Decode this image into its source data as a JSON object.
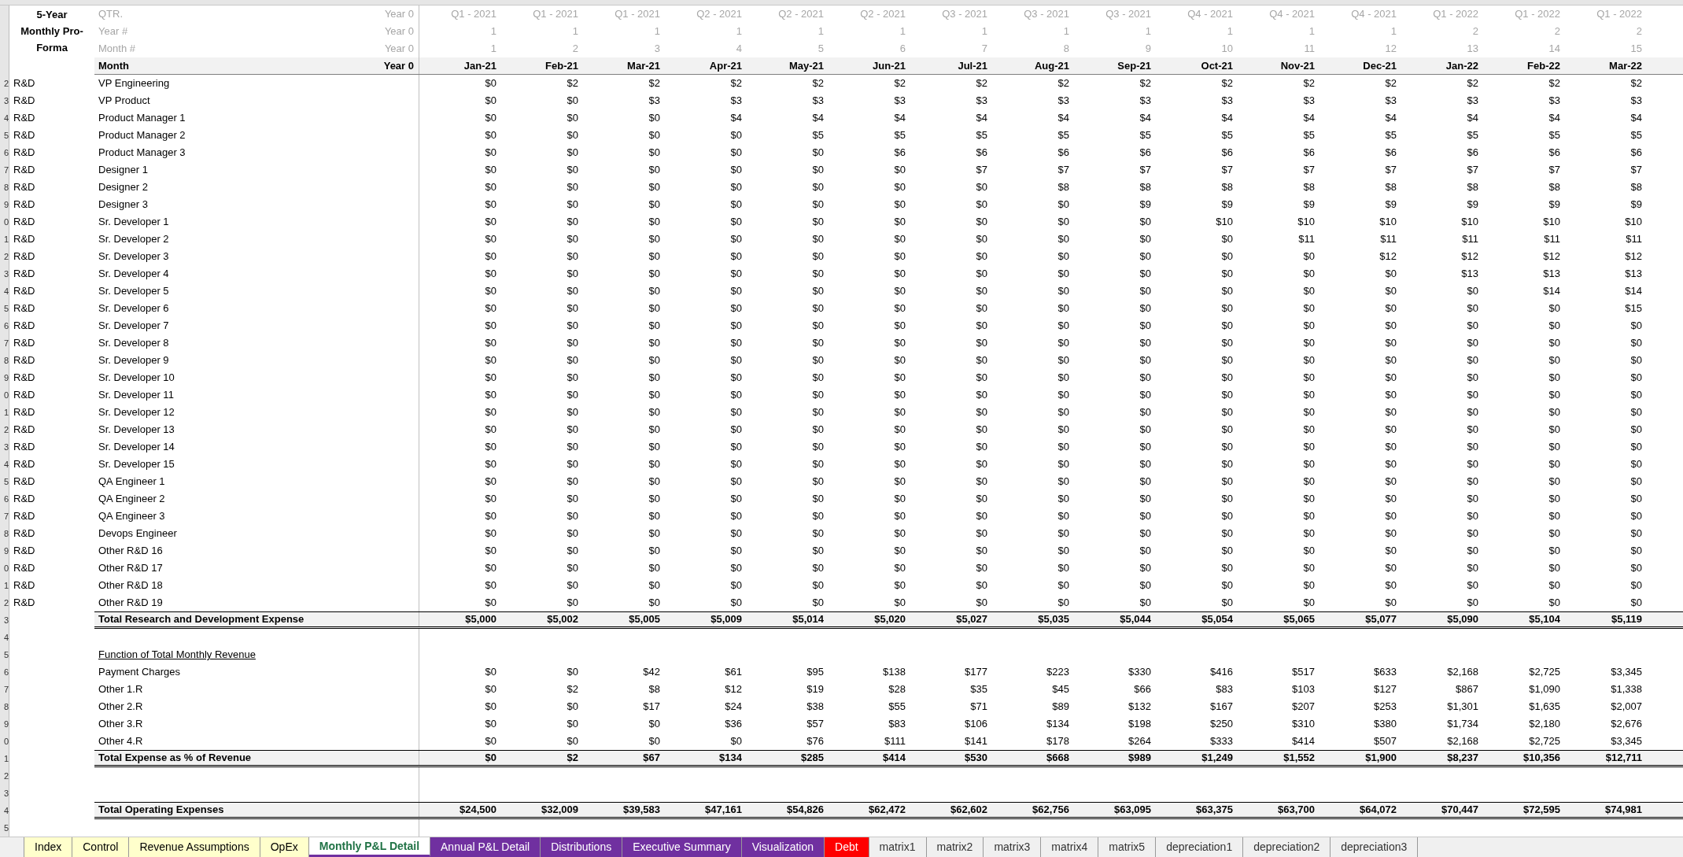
{
  "title": "5-Year Monthly Pro-Forma",
  "header_rows": [
    {
      "label": "QTR.",
      "year0": "Year 0",
      "values": [
        "Q1 - 2021",
        "Q1 - 2021",
        "Q1 - 2021",
        "Q2 - 2021",
        "Q2 - 2021",
        "Q2 - 2021",
        "Q3 - 2021",
        "Q3 - 2021",
        "Q3 - 2021",
        "Q4 - 2021",
        "Q4 - 2021",
        "Q4 - 2021",
        "Q1 - 2022",
        "Q1 - 2022",
        "Q1 - 2022"
      ]
    },
    {
      "label": "Year #",
      "year0": "Year 0",
      "values": [
        "1",
        "1",
        "1",
        "1",
        "1",
        "1",
        "1",
        "1",
        "1",
        "1",
        "1",
        "1",
        "2",
        "2",
        "2"
      ]
    },
    {
      "label": "Month #",
      "year0": "Year 0",
      "values": [
        "1",
        "2",
        "3",
        "4",
        "5",
        "6",
        "7",
        "8",
        "9",
        "10",
        "11",
        "12",
        "13",
        "14",
        "15"
      ]
    }
  ],
  "month_header": {
    "label": "Month",
    "year0": "Year 0",
    "values": [
      "Jan-21",
      "Feb-21",
      "Mar-21",
      "Apr-21",
      "May-21",
      "Jun-21",
      "Jul-21",
      "Aug-21",
      "Sep-21",
      "Oct-21",
      "Nov-21",
      "Dec-21",
      "Jan-22",
      "Feb-22",
      "Mar-22"
    ]
  },
  "rows": [
    {
      "row_number": "2",
      "kind": "item",
      "category": "R&D",
      "label": "VP Engineering",
      "values": [
        "$0",
        "$2",
        "$2",
        "$2",
        "$2",
        "$2",
        "$2",
        "$2",
        "$2",
        "$2",
        "$2",
        "$2",
        "$2",
        "$2",
        "$2"
      ]
    },
    {
      "row_number": "3",
      "kind": "item",
      "category": "R&D",
      "label": "VP Product",
      "values": [
        "$0",
        "$0",
        "$3",
        "$3",
        "$3",
        "$3",
        "$3",
        "$3",
        "$3",
        "$3",
        "$3",
        "$3",
        "$3",
        "$3",
        "$3"
      ]
    },
    {
      "row_number": "4",
      "kind": "item",
      "category": "R&D",
      "label": "Product Manager 1",
      "values": [
        "$0",
        "$0",
        "$0",
        "$4",
        "$4",
        "$4",
        "$4",
        "$4",
        "$4",
        "$4",
        "$4",
        "$4",
        "$4",
        "$4",
        "$4"
      ]
    },
    {
      "row_number": "5",
      "kind": "item",
      "category": "R&D",
      "label": "Product Manager 2",
      "values": [
        "$0",
        "$0",
        "$0",
        "$0",
        "$5",
        "$5",
        "$5",
        "$5",
        "$5",
        "$5",
        "$5",
        "$5",
        "$5",
        "$5",
        "$5"
      ]
    },
    {
      "row_number": "6",
      "kind": "item",
      "category": "R&D",
      "label": "Product Manager 3",
      "values": [
        "$0",
        "$0",
        "$0",
        "$0",
        "$0",
        "$6",
        "$6",
        "$6",
        "$6",
        "$6",
        "$6",
        "$6",
        "$6",
        "$6",
        "$6"
      ]
    },
    {
      "row_number": "7",
      "kind": "item",
      "category": "R&D",
      "label": "Designer 1",
      "values": [
        "$0",
        "$0",
        "$0",
        "$0",
        "$0",
        "$0",
        "$7",
        "$7",
        "$7",
        "$7",
        "$7",
        "$7",
        "$7",
        "$7",
        "$7"
      ]
    },
    {
      "row_number": "8",
      "kind": "item",
      "category": "R&D",
      "label": "Designer 2",
      "values": [
        "$0",
        "$0",
        "$0",
        "$0",
        "$0",
        "$0",
        "$0",
        "$8",
        "$8",
        "$8",
        "$8",
        "$8",
        "$8",
        "$8",
        "$8"
      ]
    },
    {
      "row_number": "9",
      "kind": "item",
      "category": "R&D",
      "label": "Designer 3",
      "values": [
        "$0",
        "$0",
        "$0",
        "$0",
        "$0",
        "$0",
        "$0",
        "$0",
        "$9",
        "$9",
        "$9",
        "$9",
        "$9",
        "$9",
        "$9"
      ]
    },
    {
      "row_number": "0",
      "kind": "item",
      "category": "R&D",
      "label": "Sr. Developer 1",
      "values": [
        "$0",
        "$0",
        "$0",
        "$0",
        "$0",
        "$0",
        "$0",
        "$0",
        "$0",
        "$10",
        "$10",
        "$10",
        "$10",
        "$10",
        "$10"
      ]
    },
    {
      "row_number": "1",
      "kind": "item",
      "category": "R&D",
      "label": "Sr. Developer 2",
      "values": [
        "$0",
        "$0",
        "$0",
        "$0",
        "$0",
        "$0",
        "$0",
        "$0",
        "$0",
        "$0",
        "$11",
        "$11",
        "$11",
        "$11",
        "$11"
      ]
    },
    {
      "row_number": "2",
      "kind": "item",
      "category": "R&D",
      "label": "Sr. Developer 3",
      "values": [
        "$0",
        "$0",
        "$0",
        "$0",
        "$0",
        "$0",
        "$0",
        "$0",
        "$0",
        "$0",
        "$0",
        "$12",
        "$12",
        "$12",
        "$12"
      ]
    },
    {
      "row_number": "3",
      "kind": "item",
      "category": "R&D",
      "label": "Sr. Developer 4",
      "values": [
        "$0",
        "$0",
        "$0",
        "$0",
        "$0",
        "$0",
        "$0",
        "$0",
        "$0",
        "$0",
        "$0",
        "$0",
        "$13",
        "$13",
        "$13"
      ]
    },
    {
      "row_number": "4",
      "kind": "item",
      "category": "R&D",
      "label": "Sr. Developer 5",
      "values": [
        "$0",
        "$0",
        "$0",
        "$0",
        "$0",
        "$0",
        "$0",
        "$0",
        "$0",
        "$0",
        "$0",
        "$0",
        "$0",
        "$14",
        "$14"
      ]
    },
    {
      "row_number": "5",
      "kind": "item",
      "category": "R&D",
      "label": "Sr. Developer 6",
      "values": [
        "$0",
        "$0",
        "$0",
        "$0",
        "$0",
        "$0",
        "$0",
        "$0",
        "$0",
        "$0",
        "$0",
        "$0",
        "$0",
        "$0",
        "$15"
      ]
    },
    {
      "row_number": "6",
      "kind": "item",
      "category": "R&D",
      "label": "Sr. Developer 7",
      "values": [
        "$0",
        "$0",
        "$0",
        "$0",
        "$0",
        "$0",
        "$0",
        "$0",
        "$0",
        "$0",
        "$0",
        "$0",
        "$0",
        "$0",
        "$0"
      ]
    },
    {
      "row_number": "7",
      "kind": "item",
      "category": "R&D",
      "label": "Sr. Developer 8",
      "values": [
        "$0",
        "$0",
        "$0",
        "$0",
        "$0",
        "$0",
        "$0",
        "$0",
        "$0",
        "$0",
        "$0",
        "$0",
        "$0",
        "$0",
        "$0"
      ]
    },
    {
      "row_number": "8",
      "kind": "item",
      "category": "R&D",
      "label": "Sr. Developer 9",
      "values": [
        "$0",
        "$0",
        "$0",
        "$0",
        "$0",
        "$0",
        "$0",
        "$0",
        "$0",
        "$0",
        "$0",
        "$0",
        "$0",
        "$0",
        "$0"
      ]
    },
    {
      "row_number": "9",
      "kind": "item",
      "category": "R&D",
      "label": "Sr. Developer 10",
      "values": [
        "$0",
        "$0",
        "$0",
        "$0",
        "$0",
        "$0",
        "$0",
        "$0",
        "$0",
        "$0",
        "$0",
        "$0",
        "$0",
        "$0",
        "$0"
      ]
    },
    {
      "row_number": "0",
      "kind": "item",
      "category": "R&D",
      "label": "Sr. Developer 11",
      "values": [
        "$0",
        "$0",
        "$0",
        "$0",
        "$0",
        "$0",
        "$0",
        "$0",
        "$0",
        "$0",
        "$0",
        "$0",
        "$0",
        "$0",
        "$0"
      ]
    },
    {
      "row_number": "1",
      "kind": "item",
      "category": "R&D",
      "label": "Sr. Developer 12",
      "values": [
        "$0",
        "$0",
        "$0",
        "$0",
        "$0",
        "$0",
        "$0",
        "$0",
        "$0",
        "$0",
        "$0",
        "$0",
        "$0",
        "$0",
        "$0"
      ]
    },
    {
      "row_number": "2",
      "kind": "item",
      "category": "R&D",
      "label": "Sr. Developer 13",
      "values": [
        "$0",
        "$0",
        "$0",
        "$0",
        "$0",
        "$0",
        "$0",
        "$0",
        "$0",
        "$0",
        "$0",
        "$0",
        "$0",
        "$0",
        "$0"
      ]
    },
    {
      "row_number": "3",
      "kind": "item",
      "category": "R&D",
      "label": "Sr. Developer 14",
      "values": [
        "$0",
        "$0",
        "$0",
        "$0",
        "$0",
        "$0",
        "$0",
        "$0",
        "$0",
        "$0",
        "$0",
        "$0",
        "$0",
        "$0",
        "$0"
      ]
    },
    {
      "row_number": "4",
      "kind": "item",
      "category": "R&D",
      "label": "Sr. Developer 15",
      "values": [
        "$0",
        "$0",
        "$0",
        "$0",
        "$0",
        "$0",
        "$0",
        "$0",
        "$0",
        "$0",
        "$0",
        "$0",
        "$0",
        "$0",
        "$0"
      ]
    },
    {
      "row_number": "5",
      "kind": "item",
      "category": "R&D",
      "label": "QA Engineer 1",
      "values": [
        "$0",
        "$0",
        "$0",
        "$0",
        "$0",
        "$0",
        "$0",
        "$0",
        "$0",
        "$0",
        "$0",
        "$0",
        "$0",
        "$0",
        "$0"
      ]
    },
    {
      "row_number": "6",
      "kind": "item",
      "category": "R&D",
      "label": "QA Engineer 2",
      "values": [
        "$0",
        "$0",
        "$0",
        "$0",
        "$0",
        "$0",
        "$0",
        "$0",
        "$0",
        "$0",
        "$0",
        "$0",
        "$0",
        "$0",
        "$0"
      ]
    },
    {
      "row_number": "7",
      "kind": "item",
      "category": "R&D",
      "label": "QA Engineer 3",
      "values": [
        "$0",
        "$0",
        "$0",
        "$0",
        "$0",
        "$0",
        "$0",
        "$0",
        "$0",
        "$0",
        "$0",
        "$0",
        "$0",
        "$0",
        "$0"
      ]
    },
    {
      "row_number": "8",
      "kind": "item",
      "category": "R&D",
      "label": "Devops Engineer",
      "values": [
        "$0",
        "$0",
        "$0",
        "$0",
        "$0",
        "$0",
        "$0",
        "$0",
        "$0",
        "$0",
        "$0",
        "$0",
        "$0",
        "$0",
        "$0"
      ]
    },
    {
      "row_number": "9",
      "kind": "item",
      "category": "R&D",
      "label": "Other R&D 16",
      "values": [
        "$0",
        "$0",
        "$0",
        "$0",
        "$0",
        "$0",
        "$0",
        "$0",
        "$0",
        "$0",
        "$0",
        "$0",
        "$0",
        "$0",
        "$0"
      ]
    },
    {
      "row_number": "0",
      "kind": "item",
      "category": "R&D",
      "label": "Other R&D 17",
      "values": [
        "$0",
        "$0",
        "$0",
        "$0",
        "$0",
        "$0",
        "$0",
        "$0",
        "$0",
        "$0",
        "$0",
        "$0",
        "$0",
        "$0",
        "$0"
      ]
    },
    {
      "row_number": "1",
      "kind": "item",
      "category": "R&D",
      "label": "Other R&D 18",
      "values": [
        "$0",
        "$0",
        "$0",
        "$0",
        "$0",
        "$0",
        "$0",
        "$0",
        "$0",
        "$0",
        "$0",
        "$0",
        "$0",
        "$0",
        "$0"
      ]
    },
    {
      "row_number": "2",
      "kind": "item",
      "category": "R&D",
      "label": "Other R&D 19",
      "values": [
        "$0",
        "$0",
        "$0",
        "$0",
        "$0",
        "$0",
        "$0",
        "$0",
        "$0",
        "$0",
        "$0",
        "$0",
        "$0",
        "$0",
        "$0"
      ]
    },
    {
      "row_number": "3",
      "kind": "total",
      "label": "Total Research and Development Expense",
      "values": [
        "$5,000",
        "$5,002",
        "$5,005",
        "$5,009",
        "$5,014",
        "$5,020",
        "$5,027",
        "$5,035",
        "$5,044",
        "$5,054",
        "$5,065",
        "$5,077",
        "$5,090",
        "$5,104",
        "$5,119"
      ]
    },
    {
      "row_number": "4",
      "kind": "blank"
    },
    {
      "row_number": "5",
      "kind": "section",
      "label": "Function of Total Monthly Revenue"
    },
    {
      "row_number": "6",
      "kind": "item",
      "label": "Payment Charges",
      "values": [
        "$0",
        "$0",
        "$42",
        "$61",
        "$95",
        "$138",
        "$177",
        "$223",
        "$330",
        "$416",
        "$517",
        "$633",
        "$2,168",
        "$2,725",
        "$3,345"
      ]
    },
    {
      "row_number": "7",
      "kind": "item",
      "label": "Other 1.R",
      "values": [
        "$0",
        "$2",
        "$8",
        "$12",
        "$19",
        "$28",
        "$35",
        "$45",
        "$66",
        "$83",
        "$103",
        "$127",
        "$867",
        "$1,090",
        "$1,338"
      ]
    },
    {
      "row_number": "8",
      "kind": "item",
      "label": "Other 2.R",
      "values": [
        "$0",
        "$0",
        "$17",
        "$24",
        "$38",
        "$55",
        "$71",
        "$89",
        "$132",
        "$167",
        "$207",
        "$253",
        "$1,301",
        "$1,635",
        "$2,007"
      ]
    },
    {
      "row_number": "9",
      "kind": "item",
      "label": "Other 3.R",
      "values": [
        "$0",
        "$0",
        "$0",
        "$36",
        "$57",
        "$83",
        "$106",
        "$134",
        "$198",
        "$250",
        "$310",
        "$380",
        "$1,734",
        "$2,180",
        "$2,676"
      ]
    },
    {
      "row_number": "0",
      "kind": "item",
      "label": "Other 4.R",
      "values": [
        "$0",
        "$0",
        "$0",
        "$0",
        "$76",
        "$111",
        "$141",
        "$178",
        "$264",
        "$333",
        "$414",
        "$507",
        "$2,168",
        "$2,725",
        "$3,345"
      ]
    },
    {
      "row_number": "1",
      "kind": "total",
      "label": "Total Expense as % of Revenue",
      "values": [
        "$0",
        "$2",
        "$67",
        "$134",
        "$285",
        "$414",
        "$530",
        "$668",
        "$989",
        "$1,249",
        "$1,552",
        "$1,900",
        "$8,237",
        "$10,356",
        "$12,711"
      ]
    },
    {
      "row_number": "2",
      "kind": "blank"
    },
    {
      "row_number": "3",
      "kind": "blank"
    },
    {
      "row_number": "4",
      "kind": "total",
      "label": "Total Operating Expenses",
      "values": [
        "$24,500",
        "$32,009",
        "$39,583",
        "$47,161",
        "$54,826",
        "$62,472",
        "$62,602",
        "$62,756",
        "$63,095",
        "$63,375",
        "$63,700",
        "$64,072",
        "$70,447",
        "$72,595",
        "$74,981"
      ]
    },
    {
      "row_number": "5",
      "kind": "blank"
    }
  ],
  "sheet_tabs": [
    {
      "label": "Index",
      "selected": false,
      "color": "#ffffcc"
    },
    {
      "label": "Control",
      "selected": false,
      "color": "#ffffcc"
    },
    {
      "label": "Revenue Assumptions",
      "selected": false,
      "color": "#ffffcc"
    },
    {
      "label": "OpEx",
      "selected": false,
      "color": "#ffffcc"
    },
    {
      "label": "Monthly P&L Detail",
      "selected": true,
      "color": "#7030a0"
    },
    {
      "label": "Annual P&L Detail",
      "selected": false,
      "color": "#7030a0"
    },
    {
      "label": "Distributions",
      "selected": false,
      "color": "#7030a0"
    },
    {
      "label": "Executive Summary",
      "selected": false,
      "color": "#7030a0"
    },
    {
      "label": "Visualization",
      "selected": false,
      "color": "#7030a0"
    },
    {
      "label": "Debt",
      "selected": false,
      "color": "#ff0000"
    },
    {
      "label": "matrix1",
      "selected": false
    },
    {
      "label": "matrix2",
      "selected": false
    },
    {
      "label": "matrix3",
      "selected": false
    },
    {
      "label": "matrix4",
      "selected": false
    },
    {
      "label": "matrix5",
      "selected": false
    },
    {
      "label": "depreciation1",
      "selected": false
    },
    {
      "label": "depreciation2",
      "selected": false
    },
    {
      "label": "depreciation3",
      "selected": false
    }
  ]
}
